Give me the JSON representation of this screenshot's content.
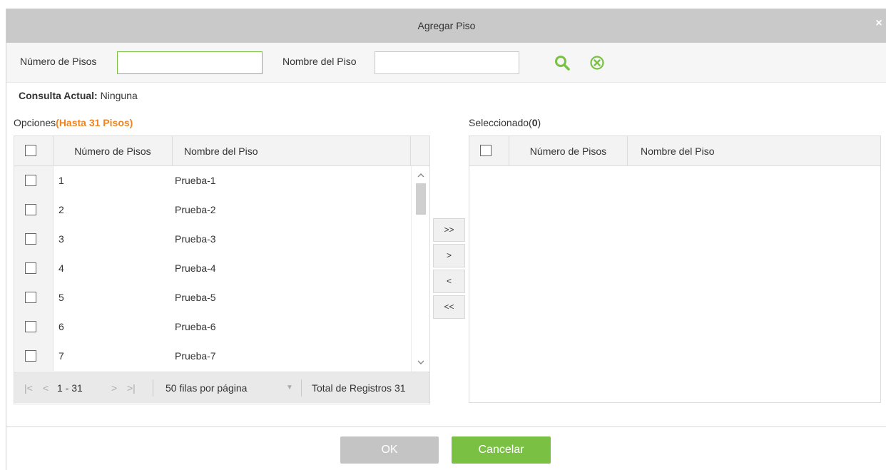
{
  "dialog": {
    "title": "Agregar Piso",
    "close_glyph": "×"
  },
  "search": {
    "floor_number_label": "Número de Pisos",
    "floor_number_value": "",
    "floor_name_label": "Nombre del Piso",
    "floor_name_value": "",
    "search_icon": "search-icon",
    "clear_icon": "clear-icon"
  },
  "query": {
    "label": "Consulta Actual:",
    "value": "Ninguna"
  },
  "options": {
    "label": "Opciones",
    "limit": "(Hasta 31 Pisos)",
    "columns": [
      "Número de Pisos",
      "Nombre del Piso"
    ],
    "rows": [
      {
        "number": "1",
        "name": "Prueba-1"
      },
      {
        "number": "2",
        "name": "Prueba-2"
      },
      {
        "number": "3",
        "name": "Prueba-3"
      },
      {
        "number": "4",
        "name": "Prueba-4"
      },
      {
        "number": "5",
        "name": "Prueba-5"
      },
      {
        "number": "6",
        "name": "Prueba-6"
      },
      {
        "number": "7",
        "name": "Prueba-7"
      }
    ],
    "pager": {
      "first": "|<",
      "prev": "<",
      "range": "1 - 31",
      "next": ">",
      "last": ">|",
      "per_page": "50 filas por página",
      "dropdown_glyph": "▼",
      "total": "Total de Registros 31"
    }
  },
  "selected": {
    "label": "Seleccionado(",
    "count": "0",
    "label_end": ")",
    "columns": [
      "Número de Pisos",
      "Nombre del Piso"
    ]
  },
  "move_buttons": {
    "add_all": ">>",
    "add": ">",
    "remove": "<",
    "remove_all": "<<"
  },
  "footer": {
    "ok": "OK",
    "cancel": "Cancelar"
  },
  "colors": {
    "accent_green": "#7ac143",
    "orange": "#f0831e",
    "titlebar": "#c9c9c9",
    "disabled": "#c4c4c4"
  }
}
